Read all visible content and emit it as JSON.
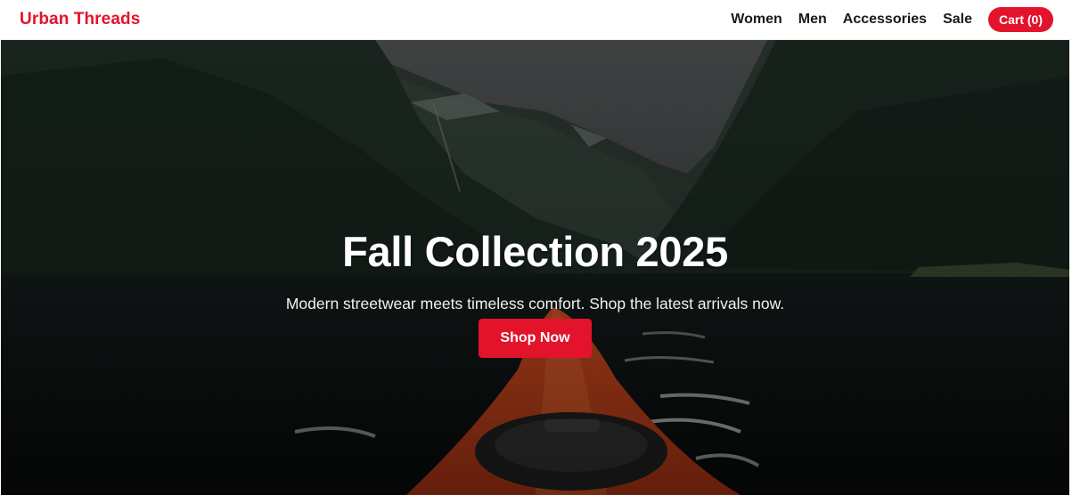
{
  "brand": {
    "name": "Urban Threads",
    "accent_color": "#e3132b"
  },
  "nav": {
    "links": [
      "Women",
      "Men",
      "Accessories",
      "Sale"
    ],
    "cart_label": "Cart (0)"
  },
  "hero": {
    "background": "photo-of-kayak-bow-in-mountain-fjord",
    "title": "Fall Collection 2025",
    "subtitle": "Modern streetwear meets timeless comfort. Shop the latest arrivals now.",
    "cta_label": "Shop Now"
  }
}
